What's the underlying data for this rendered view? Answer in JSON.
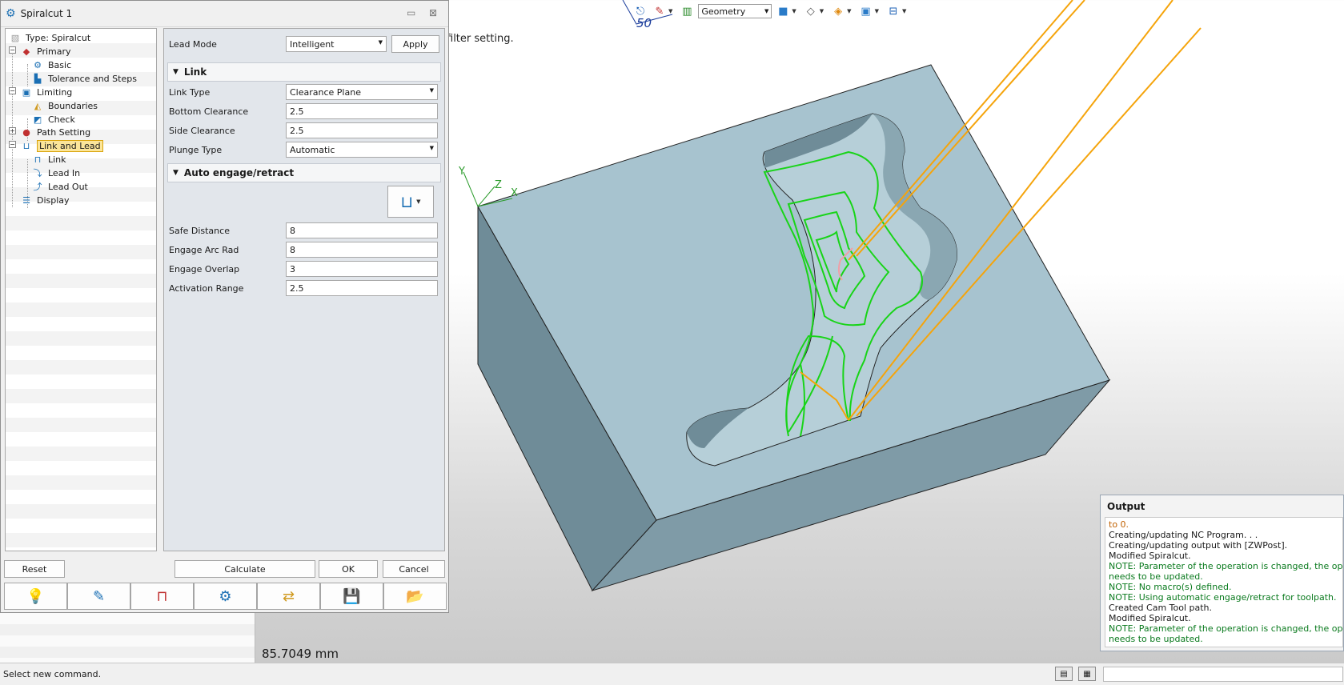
{
  "viewport": {
    "filter_text": "filter setting.",
    "scale_label": "50",
    "measure": "85.7049 mm",
    "geometry_select": "Geometry",
    "axis_y": "Y",
    "axis_z": "Z",
    "axis_x": "X"
  },
  "status": {
    "message": "Select new command."
  },
  "output": {
    "title": "Output",
    "lines": [
      {
        "text": "to 0.",
        "kind": "warn"
      },
      {
        "text": "Creating/updating NC Program. . .",
        "kind": "info"
      },
      {
        "text": "Creating/updating output with [ZWPost].",
        "kind": "info"
      },
      {
        "text": "Modified Spiralcut.",
        "kind": "info"
      },
      {
        "text": "NOTE: Parameter of the operation is changed, the operatio",
        "kind": "note"
      },
      {
        "text": "needs to be updated.",
        "kind": "note"
      },
      {
        "text": "NOTE: No macro(s) defined.",
        "kind": "note"
      },
      {
        "text": "NOTE: Using automatic engage/retract for toolpath.",
        "kind": "note"
      },
      {
        "text": "Created Cam Tool path.",
        "kind": "info"
      },
      {
        "text": "Modified Spiralcut.",
        "kind": "info"
      },
      {
        "text": "NOTE: Parameter of the operation is changed, the operatio",
        "kind": "note"
      },
      {
        "text": "needs to be updated.",
        "kind": "note"
      }
    ]
  },
  "dialog": {
    "title": "Spiralcut 1",
    "tree": {
      "type": "Type: Spiralcut",
      "primary": "Primary",
      "basic": "Basic",
      "tolerance": "Tolerance and Steps",
      "limiting": "Limiting",
      "boundaries": "Boundaries",
      "check": "Check",
      "path_setting": "Path Setting",
      "link_and_lead": "Link and Lead",
      "link": "Link",
      "lead_in": "Lead In",
      "lead_out": "Lead Out",
      "display": "Display"
    },
    "lead_mode": {
      "label": "Lead Mode",
      "value": "Intelligent",
      "apply": "Apply"
    },
    "link_section": {
      "title": "Link",
      "link_type": {
        "label": "Link Type",
        "value": "Clearance Plane"
      },
      "bottom_clearance": {
        "label": "Bottom Clearance",
        "value": "2.5"
      },
      "side_clearance": {
        "label": "Side Clearance",
        "value": "2.5"
      },
      "plunge_type": {
        "label": "Plunge Type",
        "value": "Automatic"
      }
    },
    "auto_section": {
      "title": "Auto engage/retract",
      "safe_distance": {
        "label": "Safe Distance",
        "value": "8"
      },
      "engage_arc_rad": {
        "label": "Engage Arc Rad",
        "value": "8"
      },
      "engage_overlap": {
        "label": "Engage Overlap",
        "value": "3"
      },
      "activation_range": {
        "label": "Activation Range",
        "value": "2.5"
      }
    },
    "buttons": {
      "reset": "Reset",
      "calculate": "Calculate",
      "ok": "OK",
      "cancel": "Cancel"
    }
  },
  "colors": {
    "block_top": "#a7c3cf",
    "block_left": "#6f8c98",
    "block_front": "#7f9ba7",
    "toolpath_green": "#19d419",
    "toolpath_orange": "#f5a40b",
    "selection": "#fbe59a"
  }
}
